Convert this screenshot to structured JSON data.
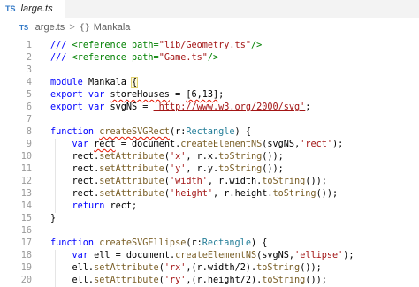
{
  "tab": {
    "icon": "TS",
    "label": "large.ts"
  },
  "breadcrumb": {
    "icon": "TS",
    "file": "large.ts",
    "separator": ">",
    "braces": "{}",
    "symbol": "Mankala"
  },
  "lines": [
    {
      "n": "1",
      "t": [
        [
          "kw",
          "/// "
        ],
        [
          "cm",
          "<reference "
        ],
        [
          "cm",
          "path="
        ],
        [
          "st",
          "\"lib/Geometry.ts\""
        ],
        [
          "cm",
          "/>"
        ]
      ]
    },
    {
      "n": "2",
      "t": [
        [
          "kw",
          "/// "
        ],
        [
          "cm",
          "<reference "
        ],
        [
          "cm",
          "path="
        ],
        [
          "st",
          "\"Game.ts\""
        ],
        [
          "cm",
          "/>"
        ]
      ]
    },
    {
      "n": "3",
      "t": []
    },
    {
      "n": "4",
      "t": [
        [
          "kw",
          "module "
        ],
        [
          "",
          "Mankala "
        ],
        [
          "hl",
          "{"
        ]
      ]
    },
    {
      "n": "5",
      "t": [
        [
          "kw",
          "export var "
        ],
        [
          "squig",
          "storeHouses"
        ],
        [
          "",
          " = "
        ],
        [
          "squig",
          "[6,13]"
        ],
        [
          "",
          ";"
        ]
      ]
    },
    {
      "n": "6",
      "t": [
        [
          "kw",
          "export var "
        ],
        [
          "",
          "svgNS = "
        ],
        [
          "stu",
          "'http://www.w3.org/2000/svg'"
        ],
        [
          "",
          ";"
        ]
      ]
    },
    {
      "n": "7",
      "t": []
    },
    {
      "n": "8",
      "t": [
        [
          "kw",
          "function "
        ],
        [
          "fnsq",
          "createSVGRect"
        ],
        [
          "",
          "(r:"
        ],
        [
          "ty",
          "Rectangle"
        ],
        [
          "",
          ") {"
        ]
      ]
    },
    {
      "n": "9",
      "t": [
        [
          "",
          "    "
        ],
        [
          "kw",
          "var "
        ],
        [
          "squig",
          "rect"
        ],
        [
          "",
          " = document."
        ],
        [
          "fn",
          "createElementNS"
        ],
        [
          "",
          "(svgNS,"
        ],
        [
          "st",
          "'rect'"
        ],
        [
          "",
          ");"
        ]
      ]
    },
    {
      "n": "10",
      "t": [
        [
          "",
          "    rect."
        ],
        [
          "fn",
          "setAttribute"
        ],
        [
          "",
          "("
        ],
        [
          "st",
          "'x'"
        ],
        [
          "",
          ", r.x."
        ],
        [
          "fn",
          "toString"
        ],
        [
          "",
          "());"
        ]
      ]
    },
    {
      "n": "11",
      "t": [
        [
          "",
          "    rect."
        ],
        [
          "fn",
          "setAttribute"
        ],
        [
          "",
          "("
        ],
        [
          "st",
          "'y'"
        ],
        [
          "",
          ", r.y."
        ],
        [
          "fn",
          "toString"
        ],
        [
          "",
          "());"
        ]
      ]
    },
    {
      "n": "12",
      "t": [
        [
          "",
          "    rect."
        ],
        [
          "fn",
          "setAttribute"
        ],
        [
          "",
          "("
        ],
        [
          "st",
          "'width'"
        ],
        [
          "",
          ", r.width."
        ],
        [
          "fn",
          "toString"
        ],
        [
          "",
          "());"
        ]
      ]
    },
    {
      "n": "13",
      "t": [
        [
          "",
          "    rect."
        ],
        [
          "fn",
          "setAttribute"
        ],
        [
          "",
          "("
        ],
        [
          "st",
          "'height'"
        ],
        [
          "",
          ", r.height."
        ],
        [
          "fn",
          "toString"
        ],
        [
          "",
          "());"
        ]
      ]
    },
    {
      "n": "14",
      "t": [
        [
          "",
          "    "
        ],
        [
          "kw",
          "return "
        ],
        [
          "",
          "rect;"
        ]
      ]
    },
    {
      "n": "15",
      "t": [
        [
          "",
          "}"
        ]
      ]
    },
    {
      "n": "16",
      "t": []
    },
    {
      "n": "17",
      "t": [
        [
          "kw",
          "function "
        ],
        [
          "fn",
          "createSVGEllipse"
        ],
        [
          "",
          "(r:"
        ],
        [
          "ty",
          "Rectangle"
        ],
        [
          "",
          ") {"
        ]
      ]
    },
    {
      "n": "18",
      "t": [
        [
          "",
          "    "
        ],
        [
          "kw",
          "var "
        ],
        [
          "",
          "ell = document."
        ],
        [
          "fn",
          "createElementNS"
        ],
        [
          "",
          "(svgNS,"
        ],
        [
          "st",
          "'ellipse'"
        ],
        [
          "",
          ");"
        ]
      ]
    },
    {
      "n": "19",
      "t": [
        [
          "",
          "    ell."
        ],
        [
          "fn",
          "setAttribute"
        ],
        [
          "",
          "("
        ],
        [
          "st",
          "'rx'"
        ],
        [
          "",
          ",(r.width/2)."
        ],
        [
          "fn",
          "toString"
        ],
        [
          "",
          "());"
        ]
      ]
    },
    {
      "n": "20",
      "t": [
        [
          "",
          "    ell."
        ],
        [
          "fn",
          "setAttribute"
        ],
        [
          "",
          "("
        ],
        [
          "st",
          "'ry'"
        ],
        [
          "",
          ",(r.height/2)."
        ],
        [
          "fn",
          "toString"
        ],
        [
          "",
          "());"
        ]
      ]
    }
  ]
}
